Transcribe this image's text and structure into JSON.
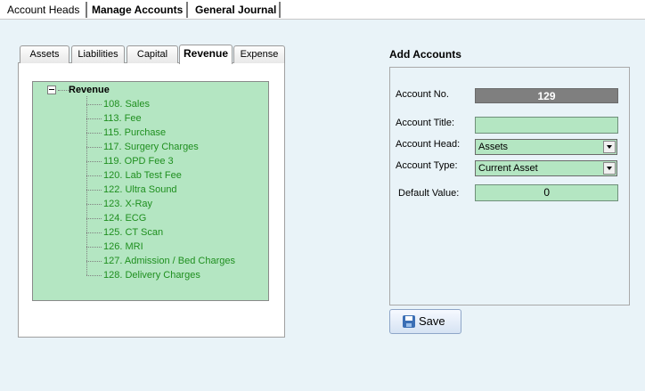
{
  "top_tabs": [
    {
      "label": "Account Heads"
    },
    {
      "label": "Manage Accounts"
    },
    {
      "label": "General Journal"
    }
  ],
  "category_tabs": [
    {
      "label": "Assets"
    },
    {
      "label": "Liabilities"
    },
    {
      "label": "Capital"
    },
    {
      "label": "Revenue",
      "active": true
    },
    {
      "label": "Expense"
    }
  ],
  "tree": {
    "root": "Revenue",
    "items": [
      "108. Sales",
      "113. Fee",
      "115. Purchase",
      "117. Surgery Charges",
      "119. OPD Fee 3",
      "120. Lab Test Fee",
      "122. Ultra Sound",
      "123. X-Ray",
      "124. ECG",
      "125. CT Scan",
      "126. MRI",
      "127. Admission / Bed Charges",
      "128. Delivery Charges"
    ]
  },
  "form": {
    "title": "Add Accounts",
    "account_no_label": "Account No.",
    "account_no_value": "129",
    "account_title_label": "Account Title:",
    "account_title_value": "",
    "account_head_label": "Account Head:",
    "account_head_value": "Assets",
    "account_type_label": "Account Type:",
    "account_type_value": "Current Asset",
    "default_value_label": "Default Value:",
    "default_value_value": "0"
  },
  "save_label": "Save",
  "colors": {
    "background": "#e9f3f8",
    "field_green": "#b4e6c2",
    "tree_text": "#1f8f1f",
    "account_no_bg": "#7f7f7f"
  }
}
